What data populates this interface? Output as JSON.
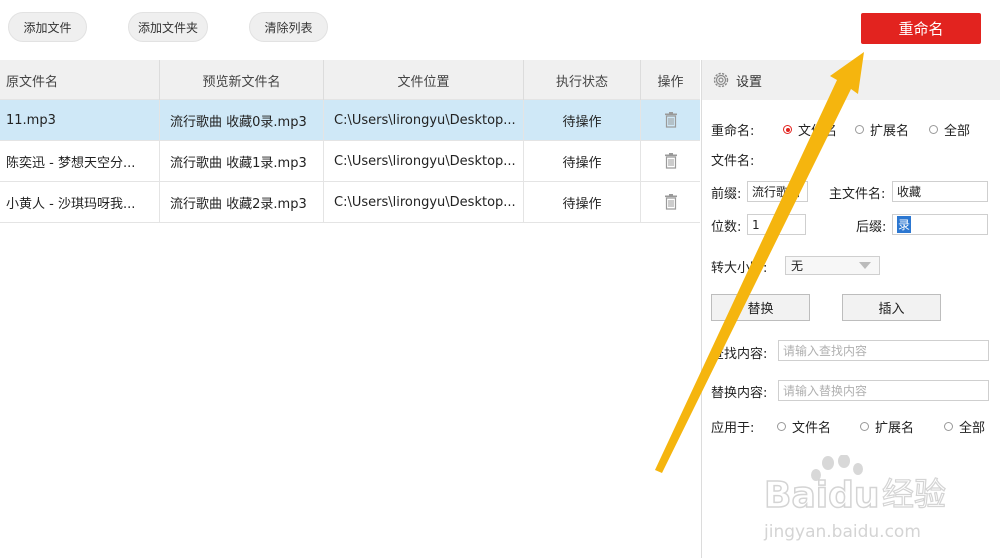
{
  "toolbar": {
    "add_file": "添加文件",
    "add_folder": "添加文件夹",
    "clear_list": "清除列表",
    "rename": "重命名"
  },
  "table": {
    "headers": [
      "原文件名",
      "预览新文件名",
      "文件位置",
      "执行状态",
      "操作"
    ],
    "rows": [
      {
        "original": "11.mp3",
        "preview": "流行歌曲 收藏0录.mp3",
        "location": "C:\\Users\\lirongyu\\Desktop...",
        "status": "待操作"
      },
      {
        "original": "陈奕迅 - 梦想天空分...",
        "preview": "流行歌曲 收藏1录.mp3",
        "location": "C:\\Users\\lirongyu\\Desktop...",
        "status": "待操作"
      },
      {
        "original": "小黄人 - 沙琪玛呀我...",
        "preview": "流行歌曲 收藏2录.mp3",
        "location": "C:\\Users\\lirongyu\\Desktop...",
        "status": "待操作"
      }
    ]
  },
  "settings": {
    "title": "设置",
    "rename_label": "重命名:",
    "rename_options": [
      "文件名",
      "扩展名",
      "全部"
    ],
    "rename_selected": 0,
    "filename_label": "文件名:",
    "prefix_label": "前缀:",
    "prefix_value": "流行歌曲",
    "main_name_label": "主文件名:",
    "main_name_value": "收藏",
    "digits_label": "位数:",
    "digits_value": "1",
    "suffix_label": "后缀:",
    "suffix_value": "录",
    "case_label": "转大小写:",
    "case_value": "无",
    "replace_button": "替换",
    "insert_button": "插入",
    "find_label": "查找内容:",
    "find_placeholder": "请输入查找内容",
    "replace_label": "替换内容:",
    "replace_placeholder": "请输入替换内容",
    "apply_label": "应用于:",
    "apply_options": [
      "文件名",
      "扩展名",
      "全部"
    ]
  },
  "watermark": {
    "brand": "Baidu",
    "brand_cn": "经验",
    "url": "jingyan.baidu.com"
  },
  "colors": {
    "accent_red": "#e2231f",
    "selected_row": "#cfe8f7",
    "arrow": "#f5b50e"
  },
  "icons": {
    "delete": "trash-icon",
    "settings": "gear-icon"
  }
}
